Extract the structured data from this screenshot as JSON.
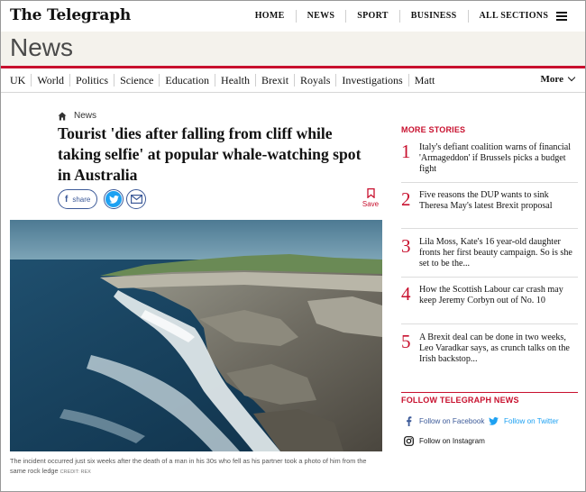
{
  "brand": {
    "logo": "The Telegraph",
    "accent": "#c8102e"
  },
  "top_nav": [
    "HOME",
    "NEWS",
    "SPORT",
    "BUSINESS",
    "ALL SECTIONS"
  ],
  "section": {
    "title": "News"
  },
  "sub_nav": [
    "UK",
    "World",
    "Politics",
    "Science",
    "Education",
    "Health",
    "Brexit",
    "Royals",
    "Investigations",
    "Matt"
  ],
  "more_label": "More",
  "breadcrumb": {
    "label": "News"
  },
  "article": {
    "headline": "Tourist 'dies after falling from cliff while taking selfie' at popular whale-watching spot in Australia",
    "share_label": "share",
    "save_label": "Save",
    "caption": "The incident occurred just six weeks after the death of a man in his 30s who fell as his partner took a photo of him from the same rock ledge",
    "credit": "CREDIT: REX"
  },
  "sidebar": {
    "title": "MORE STORIES",
    "stories": [
      {
        "num": "1",
        "text": "Italy's defiant coalition warns of financial 'Armageddon' if Brussels picks a budget fight"
      },
      {
        "num": "2",
        "text": "Five reasons the DUP wants to sink Theresa May's latest Brexit proposal"
      },
      {
        "num": "3",
        "text": "Lila Moss, Kate's 16 year-old daughter fronts her first beauty campaign. So is she set to be the..."
      },
      {
        "num": "4",
        "text": "How the Scottish Labour car crash may keep Jeremy Corbyn out of No. 10"
      },
      {
        "num": "5",
        "text": "A Brexit deal can be done in two weeks, Leo Varadkar says, as crunch talks on the Irish backstop..."
      }
    ],
    "follow_title": "FOLLOW TELEGRAPH NEWS",
    "follow": {
      "facebook": "Follow on Facebook",
      "twitter": "Follow on Twitter",
      "instagram": "Follow on Instagram"
    }
  },
  "icons": [
    "home-icon",
    "facebook-icon",
    "twitter-icon",
    "email-icon",
    "bookmark-icon",
    "hamburger-icon",
    "chevron-down-icon",
    "instagram-icon"
  ]
}
